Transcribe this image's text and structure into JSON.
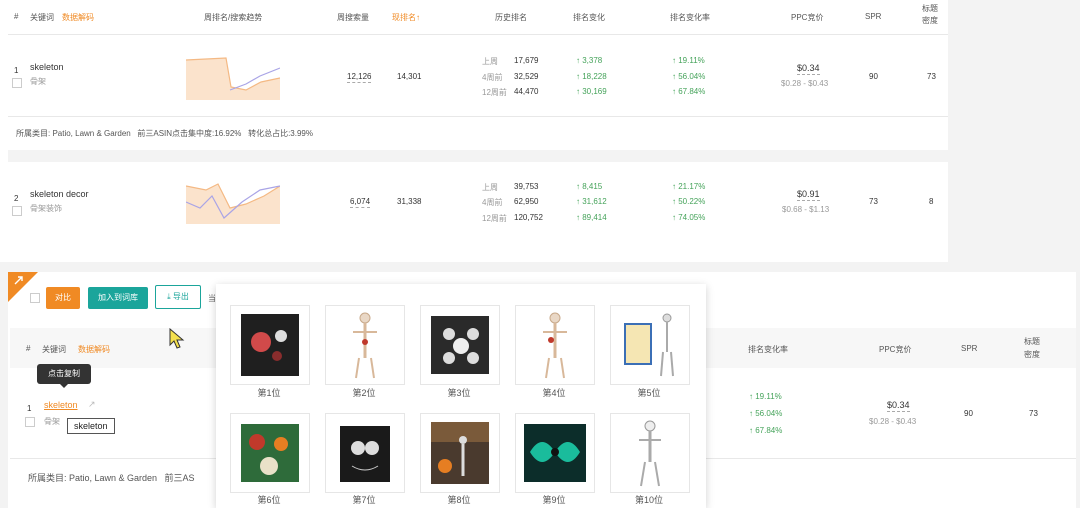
{
  "table1": {
    "headers": {
      "hash": "#",
      "keyword": "关键词",
      "data_interpret": "数据解码",
      "trend": "周排名/搜索趋势",
      "weekly_search": "周搜索量",
      "current_rank": "现排名↑",
      "history": "历史排名",
      "rank_change": "排名变化",
      "rank_change_rate": "排名变化率",
      "ppc": "PPC竞价",
      "spr": "SPR",
      "title_density": "标题\n密度"
    },
    "rows": [
      {
        "index": "1",
        "keyword": "skeleton",
        "keyword_cn": "骨架",
        "weekly_search": "12,126",
        "current_rank": "14,301",
        "history": [
          {
            "label": "上周",
            "value": "17,679",
            "change": "↑ 3,378",
            "rate": "↑ 19.11%"
          },
          {
            "label": "4周前",
            "value": "32,529",
            "change": "↑ 18,228",
            "rate": "↑ 56.04%"
          },
          {
            "label": "12周前",
            "value": "44,470",
            "change": "↑ 30,169",
            "rate": "↑ 67.84%"
          }
        ],
        "ppc": "$0.34",
        "ppc_range": "$0.28 - $0.43",
        "spr": "90",
        "title_density": "73"
      },
      {
        "index": "2",
        "keyword": "skeleton decor",
        "keyword_cn": "骨架装饰",
        "weekly_search": "6,074",
        "current_rank": "31,338",
        "history": [
          {
            "label": "上周",
            "value": "39,753",
            "change": "↑ 8,415",
            "rate": "↑ 21.17%"
          },
          {
            "label": "4周前",
            "value": "62,950",
            "change": "↑ 31,612",
            "rate": "↑ 50.22%"
          },
          {
            "label": "12周前",
            "value": "120,752",
            "change": "↑ 89,414",
            "rate": "↑ 74.05%"
          }
        ],
        "ppc": "$0.91",
        "ppc_range": "$0.68 - $1.13",
        "spr": "73",
        "title_density": "8"
      }
    ],
    "category_line": "所属类目: Patio, Lawn & Garden   前三ASIN点击集中度:16.92%   转化总占比:3.99%"
  },
  "toolbar": {
    "compare": "对比",
    "add_to_list": "加入到词库",
    "export": "导出",
    "extra": "当"
  },
  "table2": {
    "headers": {
      "hash": "#",
      "keyword": "关键词",
      "data_interpret": "数据解码",
      "rank_change_rate": "排名变化率",
      "ppc": "PPC竞价",
      "spr": "SPR",
      "title_density": "标题\n密度"
    },
    "row": {
      "index": "1",
      "keyword": "skeleton",
      "keyword_cn": "骨架",
      "rates": [
        "↑ 19.11%",
        "↑ 56.04%",
        "↑ 67.84%"
      ],
      "ppc": "$0.34",
      "ppc_range": "$0.28 - $0.43",
      "spr": "90",
      "title_density": "73"
    },
    "category_line": "所属类目: Patio, Lawn & Garden   前三AS"
  },
  "tooltip": {
    "copy": "点击复制",
    "keyword_box": "skeleton"
  },
  "popup": {
    "items": [
      "第1位",
      "第2位",
      "第3位",
      "第4位",
      "第5位",
      "第6位",
      "第7位",
      "第8位",
      "第9位",
      "第10位"
    ]
  },
  "colors": {
    "orange": "#f08a24",
    "teal": "#1ba59b",
    "green": "#45a35a"
  }
}
